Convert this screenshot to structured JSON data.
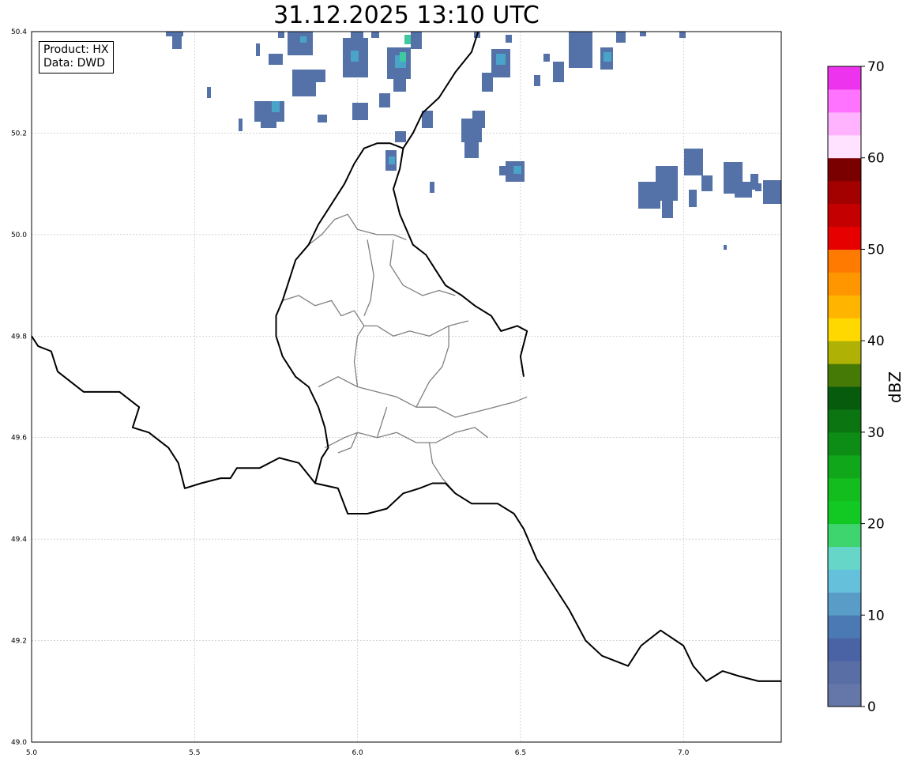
{
  "title": "31.12.2025 13:10 UTC",
  "info": {
    "product": "Product: HX",
    "source": "Data: DWD"
  },
  "axes": {
    "x_range": [
      5.0,
      7.3
    ],
    "y_range": [
      49.0,
      50.4
    ],
    "x_ticks": [
      "5.0",
      "5.5",
      "6.0",
      "6.5",
      "7.0"
    ],
    "y_ticks": [
      "49.0",
      "49.2",
      "49.4",
      "49.6",
      "49.8",
      "50.0",
      "50.2",
      "50.4"
    ],
    "grid": true
  },
  "colorbar": {
    "label": "dBZ",
    "range": [
      0,
      70
    ],
    "step": 2.5,
    "ticks": [
      "0",
      "10",
      "20",
      "30",
      "40",
      "50",
      "60",
      "70"
    ],
    "colors": [
      "#6477a8",
      "#5a6ea6",
      "#4a63a5",
      "#4a79b3",
      "#5a9cc8",
      "#65c0dc",
      "#66d6c8",
      "#3ed46e",
      "#12c923",
      "#12bd1d",
      "#10a71a",
      "#0d8d16",
      "#0b7512",
      "#075b0c",
      "#467a06",
      "#afb204",
      "#ffd800",
      "#ffb400",
      "#ff9600",
      "#ff7a00",
      "#e60000",
      "#c40000",
      "#a30000",
      "#7a0000",
      "#ffe2ff",
      "#ffb3ff",
      "#ff73ff",
      "#ee33ee"
    ]
  },
  "legend_colors": {
    "country_border": "#000000",
    "canton_border": "#808080",
    "echo_light": "#5472a8",
    "echo_mid": "#4aa3c8",
    "echo_strong": "#3ec9a0"
  },
  "borders": {
    "national": [
      [
        [
          5.0,
          49.8
        ],
        [
          5.02,
          49.78
        ],
        [
          5.06,
          49.77
        ],
        [
          5.08,
          49.73
        ],
        [
          5.12,
          49.71
        ],
        [
          5.16,
          49.69
        ],
        [
          5.22,
          49.69
        ],
        [
          5.27,
          49.69
        ],
        [
          5.33,
          49.66
        ],
        [
          5.31,
          49.62
        ],
        [
          5.36,
          49.61
        ],
        [
          5.42,
          49.58
        ],
        [
          5.45,
          49.55
        ],
        [
          5.47,
          49.5
        ],
        [
          5.52,
          49.51
        ],
        [
          5.58,
          49.52
        ],
        [
          5.61,
          49.52
        ],
        [
          5.63,
          49.54
        ],
        [
          5.7,
          49.54
        ],
        [
          5.76,
          49.56
        ],
        [
          5.82,
          49.55
        ],
        [
          5.87,
          49.51
        ],
        [
          5.94,
          49.5
        ],
        [
          5.97,
          49.45
        ],
        [
          6.03,
          49.45
        ],
        [
          6.09,
          49.46
        ],
        [
          6.14,
          49.49
        ],
        [
          6.19,
          49.5
        ],
        [
          6.23,
          49.51
        ],
        [
          6.27,
          49.51
        ],
        [
          6.3,
          49.49
        ],
        [
          6.35,
          49.47
        ],
        [
          6.43,
          49.47
        ],
        [
          6.48,
          49.45
        ],
        [
          6.51,
          49.42
        ],
        [
          6.55,
          49.36
        ],
        [
          6.59,
          49.32
        ],
        [
          6.65,
          49.26
        ],
        [
          6.7,
          49.2
        ],
        [
          6.75,
          49.17
        ],
        [
          6.83,
          49.15
        ],
        [
          6.87,
          49.19
        ],
        [
          6.93,
          49.22
        ],
        [
          7.0,
          49.19
        ],
        [
          7.03,
          49.15
        ],
        [
          7.07,
          49.12
        ],
        [
          7.12,
          49.14
        ],
        [
          7.17,
          49.13
        ],
        [
          7.23,
          49.12
        ],
        [
          7.3,
          49.12
        ]
      ],
      [
        [
          6.51,
          49.72
        ],
        [
          6.5,
          49.76
        ],
        [
          6.52,
          49.81
        ],
        [
          6.49,
          49.82
        ],
        [
          6.44,
          49.81
        ],
        [
          6.41,
          49.84
        ],
        [
          6.36,
          49.86
        ],
        [
          6.32,
          49.88
        ],
        [
          6.27,
          49.9
        ],
        [
          6.24,
          49.93
        ],
        [
          6.21,
          49.96
        ],
        [
          6.17,
          49.98
        ],
        [
          6.13,
          50.04
        ],
        [
          6.11,
          50.09
        ],
        [
          6.13,
          50.13
        ],
        [
          6.14,
          50.17
        ],
        [
          6.17,
          50.2
        ],
        [
          6.2,
          50.24
        ],
        [
          6.25,
          50.27
        ],
        [
          6.3,
          50.32
        ],
        [
          6.35,
          50.36
        ],
        [
          6.37,
          50.4
        ]
      ],
      [
        [
          6.14,
          50.17
        ],
        [
          6.1,
          50.18
        ],
        [
          6.06,
          50.18
        ],
        [
          6.02,
          50.17
        ],
        [
          5.99,
          50.14
        ],
        [
          5.96,
          50.1
        ],
        [
          5.92,
          50.06
        ],
        [
          5.88,
          50.02
        ],
        [
          5.85,
          49.98
        ],
        [
          5.81,
          49.95
        ],
        [
          5.79,
          49.91
        ],
        [
          5.77,
          49.87
        ],
        [
          5.75,
          49.84
        ],
        [
          5.75,
          49.8
        ],
        [
          5.77,
          49.76
        ],
        [
          5.81,
          49.72
        ],
        [
          5.85,
          49.7
        ],
        [
          5.88,
          49.66
        ],
        [
          5.9,
          49.62
        ],
        [
          5.91,
          49.58
        ],
        [
          5.89,
          49.56
        ],
        [
          5.87,
          49.51
        ]
      ]
    ],
    "cantons": [
      [
        [
          5.85,
          49.98
        ],
        [
          5.89,
          50.0
        ],
        [
          5.93,
          50.03
        ],
        [
          5.97,
          50.04
        ],
        [
          6.0,
          50.01
        ],
        [
          6.06,
          50.0
        ],
        [
          6.11,
          50.0
        ],
        [
          6.15,
          49.99
        ]
      ],
      [
        [
          5.77,
          49.87
        ],
        [
          5.82,
          49.88
        ],
        [
          5.87,
          49.86
        ],
        [
          5.92,
          49.87
        ],
        [
          5.95,
          49.84
        ],
        [
          5.99,
          49.85
        ],
        [
          6.02,
          49.82
        ],
        [
          6.06,
          49.82
        ],
        [
          6.11,
          49.8
        ],
        [
          6.16,
          49.81
        ],
        [
          6.22,
          49.8
        ],
        [
          6.28,
          49.82
        ],
        [
          6.34,
          49.83
        ]
      ],
      [
        [
          6.03,
          49.99
        ],
        [
          6.05,
          49.92
        ],
        [
          6.04,
          49.87
        ],
        [
          6.02,
          49.84
        ]
      ],
      [
        [
          6.11,
          49.99
        ],
        [
          6.1,
          49.94
        ],
        [
          6.14,
          49.9
        ],
        [
          6.2,
          49.88
        ],
        [
          6.25,
          49.89
        ],
        [
          6.3,
          49.88
        ]
      ],
      [
        [
          5.88,
          49.7
        ],
        [
          5.94,
          49.72
        ],
        [
          6.0,
          49.7
        ],
        [
          6.06,
          49.69
        ],
        [
          6.12,
          49.68
        ],
        [
          6.18,
          49.66
        ],
        [
          6.24,
          49.66
        ],
        [
          6.3,
          49.64
        ],
        [
          6.36,
          49.65
        ],
        [
          6.42,
          49.66
        ],
        [
          6.48,
          49.67
        ],
        [
          6.52,
          49.68
        ]
      ],
      [
        [
          6.0,
          49.7
        ],
        [
          5.99,
          49.75
        ],
        [
          6.0,
          49.8
        ],
        [
          6.02,
          49.82
        ]
      ],
      [
        [
          6.18,
          49.66
        ],
        [
          6.22,
          49.71
        ],
        [
          6.26,
          49.74
        ],
        [
          6.28,
          49.78
        ],
        [
          6.28,
          49.82
        ]
      ],
      [
        [
          5.9,
          49.58
        ],
        [
          5.96,
          49.6
        ],
        [
          6.0,
          49.61
        ],
        [
          6.06,
          49.6
        ],
        [
          6.12,
          49.61
        ],
        [
          6.18,
          49.59
        ],
        [
          6.24,
          49.59
        ],
        [
          6.3,
          49.61
        ],
        [
          6.36,
          49.62
        ],
        [
          6.4,
          49.6
        ]
      ],
      [
        [
          6.06,
          49.6
        ],
        [
          6.08,
          49.64
        ],
        [
          6.09,
          49.66
        ]
      ],
      [
        [
          6.22,
          49.59
        ],
        [
          6.23,
          49.55
        ],
        [
          6.26,
          49.52
        ],
        [
          6.3,
          49.49
        ]
      ],
      [
        [
          6.0,
          49.61
        ],
        [
          5.98,
          49.58
        ],
        [
          5.94,
          49.57
        ]
      ]
    ]
  }
}
